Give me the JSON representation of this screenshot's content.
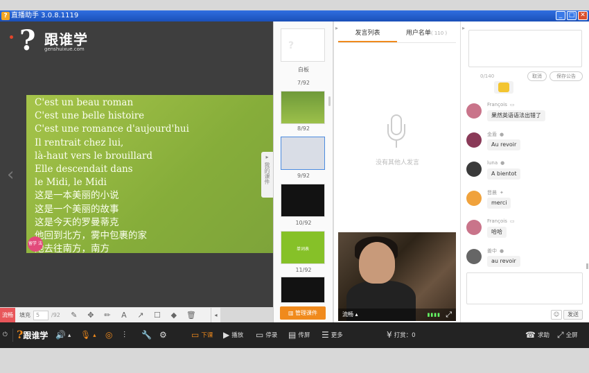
{
  "window": {
    "title": "直播助手 3.0.8.1119",
    "app_icon_glyph": "?",
    "buttons": [
      "_",
      "□",
      "✕"
    ]
  },
  "logo": {
    "mark": "?",
    "name": "跟谁学",
    "url": "genshuixue.com"
  },
  "slide": {
    "lines": [
      "C'est un beau roman",
      "C'est une belle histoire",
      "C'est une romance d'aujourd'hui",
      "Il rentrait chez lui,",
      "là-haut vers le brouillard",
      "Elle descendait dans",
      "le Midi, le Midi",
      "这是一本美丽的小说",
      "这是一个美丽的故事",
      "这是今天的罗曼蒂克",
      "他回到北方，雾中包裹的家",
      "她去往南方，南方"
    ],
    "badge": "留学 法语"
  },
  "courseware_tab": {
    "arrow": "▸",
    "label": "我的课件"
  },
  "drawbar": {
    "mode": "流畅",
    "fill_label": "填充",
    "page_value": "5",
    "page_total": "/92",
    "tools": [
      "✎",
      "✥",
      "✏",
      "A",
      "↗",
      "☐",
      "◆",
      "🗑"
    ],
    "collapse": "◂"
  },
  "thumbnails": {
    "items": [
      {
        "label": "白板",
        "kind": "white",
        "mark": "?"
      },
      {
        "label": "7/92",
        "kind": "green",
        "mark": ""
      },
      {
        "label": "8/92",
        "kind": "grid",
        "mark": ""
      },
      {
        "label": "9/92",
        "kind": "dark",
        "mark": ""
      },
      {
        "label": "10/92",
        "kind": "lime",
        "mark": "单词表"
      },
      {
        "label": "11/92",
        "kind": "dark",
        "mark": ""
      }
    ],
    "manage_button": "管理课件"
  },
  "speech_panel": {
    "tabs": [
      {
        "label": "发言列表",
        "count": ""
      },
      {
        "label": "用户名单",
        "count": "( 110 )"
      }
    ],
    "empty_text": "没有其他人发言",
    "video": {
      "mode": "流畅 ▴",
      "signal": "▮▮▮▮",
      "fullscreen_icon": "⤢"
    }
  },
  "notice": {
    "count": "0/140",
    "cancel": "取消",
    "save": "保存公告"
  },
  "chat": {
    "messages": [
      {
        "user": "François",
        "device": "▭",
        "text": "果然英语语法出错了",
        "avatar_color": "#c9748a"
      },
      {
        "user": "金盾",
        "device": "●",
        "text": "Au revoir",
        "avatar_color": "#8a3a58"
      },
      {
        "user": "luna",
        "device": "●",
        "text": "A bientot",
        "avatar_color": "#3a3a3a"
      },
      {
        "user": "晋晨",
        "device": "✦",
        "text": "merci",
        "avatar_color": "#f0a23c"
      },
      {
        "user": "François",
        "device": "▭",
        "text": "哈哈",
        "avatar_color": "#c9748a"
      },
      {
        "user": "姜中",
        "device": "●",
        "text": "au revoir",
        "avatar_color": "#666666"
      }
    ],
    "emoji_icon": "☺",
    "send": "发送"
  },
  "bottombar": {
    "power_icon": "⏻",
    "logo_mark": "?",
    "logo_name": "跟谁学",
    "items": [
      {
        "name": "volume",
        "icon": "🔊",
        "label": "▴"
      },
      {
        "name": "mic",
        "icon": "🎙",
        "label": "▴"
      },
      {
        "name": "camera",
        "icon": "◎",
        "label": ""
      },
      {
        "name": "mixer",
        "icon": "⫶",
        "label": ""
      },
      {
        "name": "tools",
        "icon": "🔧",
        "label": ""
      },
      {
        "name": "settings",
        "icon": "⚙",
        "label": ""
      },
      {
        "name": "end-class",
        "icon": "▭",
        "label": "下课"
      },
      {
        "name": "play",
        "icon": "▶",
        "label": "播放"
      },
      {
        "name": "record",
        "icon": "▭",
        "label": "停录"
      },
      {
        "name": "share-screen",
        "icon": "▤",
        "label": "传屏"
      },
      {
        "name": "more",
        "icon": "☰",
        "label": "更多"
      },
      {
        "name": "reward",
        "icon": "¥",
        "label": "打赏：0"
      },
      {
        "name": "help",
        "icon": "☎",
        "label": "求助"
      },
      {
        "name": "fullscreen",
        "icon": "⤢",
        "label": "全屏"
      }
    ]
  },
  "colors": {
    "accent": "#f08a1c",
    "titlebar": "#1a4fb8",
    "slide_green": "#8fb43f",
    "mode_red": "#e8565a"
  }
}
